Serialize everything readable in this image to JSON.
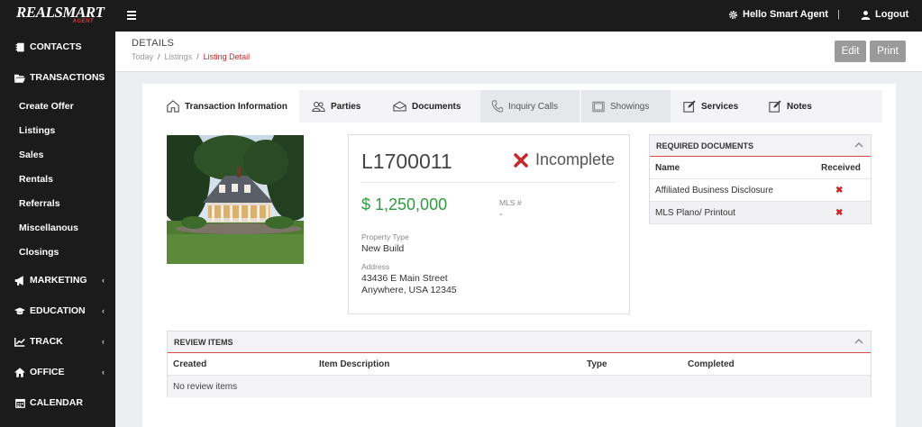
{
  "brand": {
    "name": "REALSMART",
    "sub": "AGENT"
  },
  "topbar": {
    "greeting": "Hello Smart Agent",
    "divider": "|",
    "logout": "Logout"
  },
  "sidebar": {
    "contacts": "CONTACTS",
    "transactions": "TRANSACTIONS",
    "sub_items": [
      "Create Offer",
      "Listings",
      "Sales",
      "Rentals",
      "Referrals",
      "Miscellanous",
      "Closings"
    ],
    "marketing": "MARKETING",
    "education": "EDUCATION",
    "track": "TRACK",
    "office": "OFFICE",
    "calendar": "CALENDAR"
  },
  "header": {
    "title": "DETAILS",
    "breadcrumb": [
      "Today",
      "Listings",
      "Listing Detail"
    ],
    "edit": "Edit",
    "print": "Print"
  },
  "tabs": [
    "Transaction Information",
    "Parties",
    "Documents",
    "Inquiry Calls",
    "Showings",
    "Services",
    "Notes"
  ],
  "listing": {
    "id": "L1700011",
    "status": "Incomplete",
    "price": "$ 1,250,000",
    "mls_label": "MLS #",
    "mls_value": "-",
    "property_type_label": "Property Type",
    "property_type": "New Build",
    "address_label": "Address",
    "address_line1": "43436 E Main Street",
    "address_line2": "Anywhere, USA 12345"
  },
  "required_documents": {
    "title": "REQUIRED DOCUMENTS",
    "col_name": "Name",
    "col_received": "Received",
    "rows": [
      "Affiliated Business Disclosure",
      "MLS Plano/ Printout"
    ]
  },
  "review_items": {
    "title": "REVIEW ITEMS",
    "cols": [
      "Created",
      "Item Description",
      "Type",
      "Completed"
    ],
    "empty": "No review items"
  },
  "colors": {
    "accent_red": "#c62828",
    "price_green": "#2e9b3c",
    "dark": "#1b1b1b"
  }
}
